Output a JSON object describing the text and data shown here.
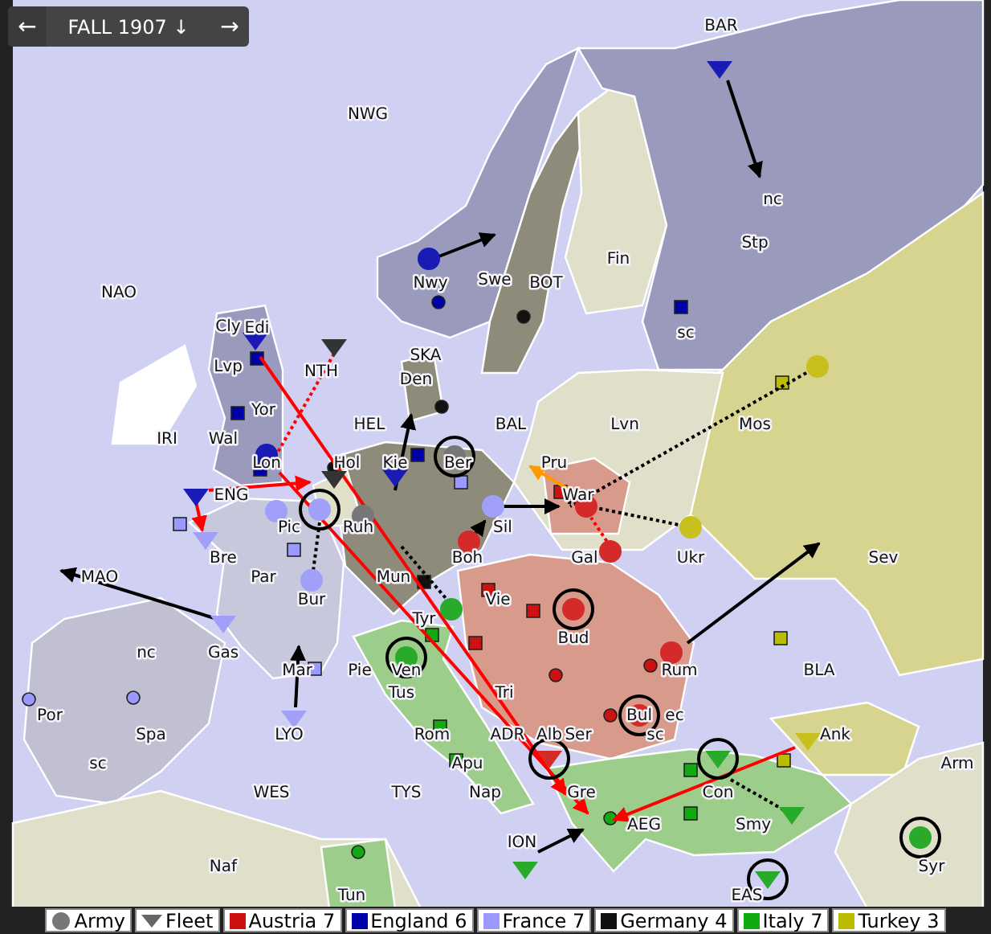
{
  "header": {
    "prev": "←",
    "title": "FALL 1907 ↓",
    "next": "→"
  },
  "provinces": [
    "BAR",
    "NWG",
    "nc",
    "Stp",
    "Fin",
    "Nwy",
    "Swe",
    "BOT",
    "NAO",
    "Cly",
    "Edi",
    "sc",
    "SKA",
    "Lvp",
    "NTH",
    "Den",
    "Yor",
    "HEL",
    "BAL",
    "Lvn",
    "Mos",
    "IRI",
    "Wal",
    "Lon",
    "Hol",
    "Kie",
    "Ber",
    "Pru",
    "ENG",
    "War",
    "Pic",
    "Ruh",
    "Sil",
    "Bre",
    "Boh",
    "Gal",
    "Ukr",
    "Sev",
    "MAO",
    "Par",
    "Mun",
    "Bur",
    "Vie",
    "Tyr",
    "Bud",
    "nc",
    "Gas",
    "Mar",
    "Pie",
    "Ven",
    "Rum",
    "BLA",
    "Tus",
    "Tri",
    "Por",
    "Bul",
    "ec",
    "Spa",
    "LYO",
    "Rom",
    "ADR",
    "Alb",
    "Ser",
    "sc",
    "Ank",
    "sc",
    "Apu",
    "Arm",
    "WES",
    "TYS",
    "Nap",
    "Gre",
    "Con",
    "AEG",
    "Smy",
    "ION",
    "Naf",
    "Syr",
    "Tun",
    "EAS"
  ],
  "units": [
    {
      "kind": "fleet",
      "color": "#1a1ab4",
      "circled": false
    },
    {
      "kind": "fleet",
      "color": "#333333",
      "circled": false
    },
    {
      "kind": "army",
      "color": "#1a1ab4",
      "circled": false
    },
    {
      "kind": "fleet",
      "color": "#1a1ab4",
      "circled": false
    },
    {
      "kind": "army",
      "color": "#777777",
      "circled": true
    },
    {
      "kind": "fleet",
      "color": "#1a1ab4",
      "circled": false
    },
    {
      "kind": "army",
      "color": "#1a1ab4",
      "circled": false
    },
    {
      "kind": "fleet",
      "color": "#1a1ab4",
      "circled": false
    },
    {
      "kind": "fleet",
      "color": "#a0a0f8",
      "circled": false
    },
    {
      "kind": "fleet",
      "color": "#333333",
      "circled": false
    },
    {
      "kind": "army",
      "color": "#a0a0f8",
      "circled": false
    },
    {
      "kind": "army",
      "color": "#a0a0f8",
      "circled": true
    },
    {
      "kind": "army",
      "color": "#777777",
      "circled": false
    },
    {
      "kind": "army",
      "color": "#a0a0f8",
      "circled": false
    },
    {
      "kind": "army",
      "color": "#a0a0f8",
      "circled": false
    },
    {
      "kind": "army",
      "color": "#d42a2a",
      "circled": false
    },
    {
      "kind": "army",
      "color": "#c8c01e",
      "circled": false
    },
    {
      "kind": "army",
      "color": "#c8c01e",
      "circled": false
    },
    {
      "kind": "army",
      "color": "#d42a2a",
      "circled": false
    },
    {
      "kind": "army",
      "color": "#d42a2a",
      "circled": false
    },
    {
      "kind": "army",
      "color": "#2aaa2a",
      "circled": false
    },
    {
      "kind": "army",
      "color": "#d42a2a",
      "circled": true
    },
    {
      "kind": "army",
      "color": "#2aaa2a",
      "circled": true
    },
    {
      "kind": "army",
      "color": "#d42a2a",
      "circled": false
    },
    {
      "kind": "fleet",
      "color": "#a0a0f8",
      "circled": false
    },
    {
      "kind": "fleet",
      "color": "#a0a0f8",
      "circled": false
    },
    {
      "kind": "army",
      "color": "#d42a2a",
      "circled": true
    },
    {
      "kind": "fleet",
      "color": "#d42a2a",
      "circled": true
    },
    {
      "kind": "fleet",
      "color": "#2aaa2a",
      "circled": true
    },
    {
      "kind": "fleet",
      "color": "#c8c01e",
      "circled": false
    },
    {
      "kind": "fleet",
      "color": "#2aaa2a",
      "circled": false
    },
    {
      "kind": "fleet",
      "color": "#2aaa2a",
      "circled": false
    },
    {
      "kind": "fleet",
      "color": "#2aaa2a",
      "circled": true
    },
    {
      "kind": "army",
      "color": "#2aaa2a",
      "circled": true
    }
  ],
  "supply_centers": [
    {
      "kind": "square",
      "color": "#0000aa"
    },
    {
      "kind": "square",
      "color": "#0000aa"
    },
    {
      "kind": "dot",
      "color": "#0000aa"
    },
    {
      "kind": "dot",
      "color": "#111111"
    },
    {
      "kind": "square",
      "color": "#0000aa"
    },
    {
      "kind": "square",
      "color": "#bbbb00"
    },
    {
      "kind": "dot",
      "color": "#111111"
    },
    {
      "kind": "square",
      "color": "#0000aa"
    },
    {
      "kind": "square",
      "color": "#0000aa"
    },
    {
      "kind": "square",
      "color": "#9999ff"
    },
    {
      "kind": "square",
      "color": "#9999ff"
    },
    {
      "kind": "square",
      "color": "#9999ff"
    },
    {
      "kind": "square",
      "color": "#111111"
    },
    {
      "kind": "dot",
      "color": "#111111"
    },
    {
      "kind": "square",
      "color": "#cc1111"
    },
    {
      "kind": "square",
      "color": "#cc1111"
    },
    {
      "kind": "square",
      "color": "#cc1111"
    },
    {
      "kind": "square",
      "color": "#cc1111"
    },
    {
      "kind": "dot",
      "color": "#cc1111"
    },
    {
      "kind": "dot",
      "color": "#cc1111"
    },
    {
      "kind": "dot",
      "color": "#cc1111"
    },
    {
      "kind": "square",
      "color": "#11aa11"
    },
    {
      "kind": "square",
      "color": "#11aa11"
    },
    {
      "kind": "square",
      "color": "#11aa11"
    },
    {
      "kind": "dot",
      "color": "#11aa11"
    },
    {
      "kind": "square",
      "color": "#9999ff"
    },
    {
      "kind": "dot",
      "color": "#9999ff"
    },
    {
      "kind": "dot",
      "color": "#9999ff"
    },
    {
      "kind": "square",
      "color": "#bbbb00"
    },
    {
      "kind": "square",
      "color": "#11aa11"
    },
    {
      "kind": "square",
      "color": "#bbbb00"
    },
    {
      "kind": "square",
      "color": "#11aa11"
    },
    {
      "kind": "dot",
      "color": "#11aa11"
    }
  ],
  "legend": [
    {
      "kind": "army",
      "label": "Army"
    },
    {
      "kind": "fleet",
      "label": "Fleet"
    },
    {
      "kind": "power",
      "label": "Austria 7",
      "color": "#cc1111"
    },
    {
      "kind": "power",
      "label": "England 6",
      "color": "#0000aa"
    },
    {
      "kind": "power",
      "label": "France 7",
      "color": "#9999ff"
    },
    {
      "kind": "power",
      "label": "Germany 4",
      "color": "#111111"
    },
    {
      "kind": "power",
      "label": "Italy 7",
      "color": "#11aa11"
    },
    {
      "kind": "power",
      "label": "Turkey 3",
      "color": "#bbbb00"
    }
  ]
}
